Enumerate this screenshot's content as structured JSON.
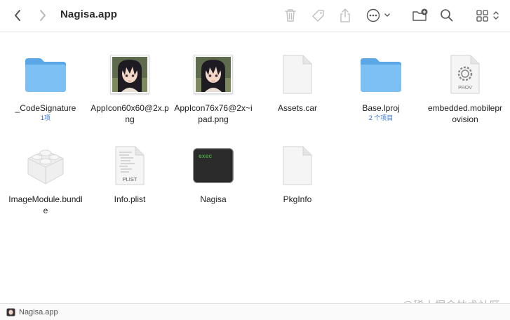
{
  "window": {
    "title": "Nagisa.app"
  },
  "toolbar": {
    "back": "chevron-left-icon",
    "forward": "chevron-right-icon",
    "icons": [
      "trash-icon",
      "tag-icon",
      "share-icon",
      "more-icon",
      "new-folder-icon",
      "search-icon",
      "view-grid-icon"
    ]
  },
  "files": [
    {
      "name": "_CodeSignature",
      "sub": "1项",
      "type": "folder"
    },
    {
      "name": "AppIcon60x60@2x.png",
      "type": "image"
    },
    {
      "name": "AppIcon76x76@2x~ipad.png",
      "type": "image"
    },
    {
      "name": "Assets.car",
      "type": "document"
    },
    {
      "name": "Base.lproj",
      "sub": "2 个项目",
      "type": "folder"
    },
    {
      "name": "embedded.mobileprovision",
      "badge": "PROV",
      "type": "provision"
    },
    {
      "name": "ImageModule.bundle",
      "type": "bundle"
    },
    {
      "name": "Info.plist",
      "badge": "PLIST",
      "type": "plist"
    },
    {
      "name": "Nagisa",
      "badge": "exec",
      "type": "exec"
    },
    {
      "name": "PkgInfo",
      "type": "document"
    }
  ],
  "statusbar": {
    "path": "Nagisa.app"
  },
  "watermark": "@稀土掘金技术社区",
  "colors": {
    "folder": "#6fb5ee",
    "link": "#2f6fd6",
    "exec_text": "#4fd14f"
  }
}
